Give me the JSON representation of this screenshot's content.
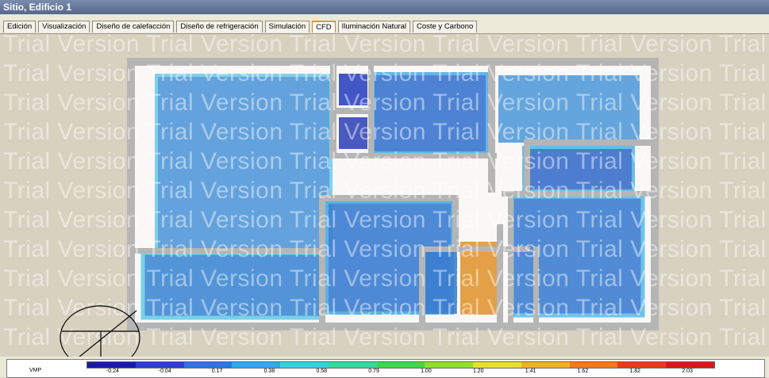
{
  "window": {
    "title": "Sitio, Edificio 1"
  },
  "tabs": [
    {
      "label": "Edición",
      "active": false
    },
    {
      "label": "Visualización",
      "active": false
    },
    {
      "label": "Diseño de calefacción",
      "active": false
    },
    {
      "label": "Diseño de refrigeración",
      "active": false
    },
    {
      "label": "Simulación",
      "active": false
    },
    {
      "label": "CFD",
      "active": true
    },
    {
      "label": "Iluminación Natural",
      "active": false
    },
    {
      "label": "Coste y Carbono",
      "active": false
    }
  ],
  "watermark": {
    "text": "Trial Version"
  },
  "legend": {
    "label": "VMP",
    "ticks": [
      "-0.24",
      "-0.04",
      "0.17",
      "0.38",
      "0.58",
      "0.79",
      "1.00",
      "1.20",
      "1.41",
      "1.62",
      "1.82",
      "2.03"
    ],
    "colors": [
      "#1a1aa8",
      "#2f3ed0",
      "#2f74e0",
      "#35a8e8",
      "#38d0e0",
      "#36d8a0",
      "#3ed84a",
      "#8ee030",
      "#e8e030",
      "#f0b028",
      "#f07820",
      "#e83a1a",
      "#d81818"
    ]
  },
  "colors": {
    "accent_tab": "#f0902a",
    "wall": "#b9b9b9",
    "room_blue": "#3f7fd2",
    "room_light": "#4fa2df",
    "room_orange": "#e39b3c",
    "room_dark": "#3547b8"
  }
}
